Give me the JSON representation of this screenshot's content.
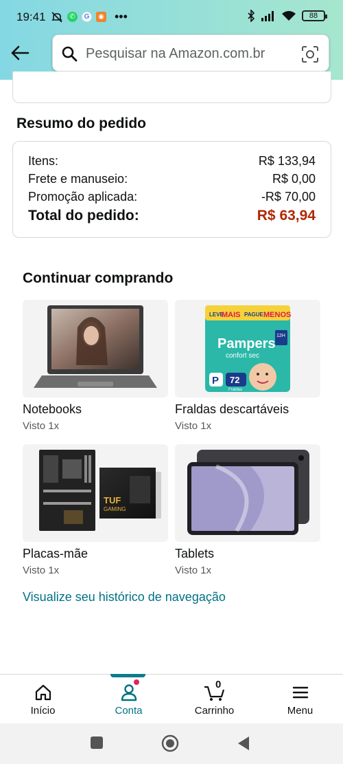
{
  "status_bar": {
    "time": "19:41",
    "battery": "88",
    "icons": [
      "mute-icon",
      "whatsapp-icon",
      "google-icon",
      "app-icon",
      "more-icon",
      "bluetooth-icon",
      "signal-icon",
      "wifi-icon",
      "battery-icon"
    ]
  },
  "header": {
    "search_placeholder": "Pesquisar na Amazon.com.br"
  },
  "summary": {
    "title": "Resumo do pedido",
    "rows": [
      {
        "label": "Itens:",
        "value": "R$ 133,94"
      },
      {
        "label": "Frete e manuseio:",
        "value": "R$ 0,00"
      },
      {
        "label": "Promoção aplicada:",
        "value": "-R$ 70,00"
      }
    ],
    "total": {
      "label": "Total do pedido:",
      "value": "R$ 63,94"
    },
    "total_color": "#b12704"
  },
  "continue": {
    "title": "Continuar comprando",
    "items": [
      {
        "name": "Notebooks",
        "seen": "Visto 1x"
      },
      {
        "name": "Fraldas descartáveis",
        "seen": "Visto 1x"
      },
      {
        "name": "Placas-mãe",
        "seen": "Visto 1x"
      },
      {
        "name": "Tablets",
        "seen": "Visto 1x"
      }
    ],
    "diaper_pack": {
      "promo_a": "LEVE",
      "promo_b": "MAIS",
      "promo_c": "PAGUE",
      "promo_d": "MENOS",
      "brand": "Pampers",
      "line": "confort sec",
      "size": "P",
      "count": "72",
      "unit": "Fraldas",
      "hours": "12H"
    },
    "board_box": {
      "brand": "TUF",
      "line": "GAMING"
    }
  },
  "history_link": "Visualize seu histórico de navegação",
  "bottom_nav": {
    "items": [
      {
        "label": "Início"
      },
      {
        "label": "Conta"
      },
      {
        "label": "Carrinho",
        "badge": "0"
      },
      {
        "label": "Menu"
      }
    ],
    "active": "Conta",
    "accent": "#007185"
  }
}
